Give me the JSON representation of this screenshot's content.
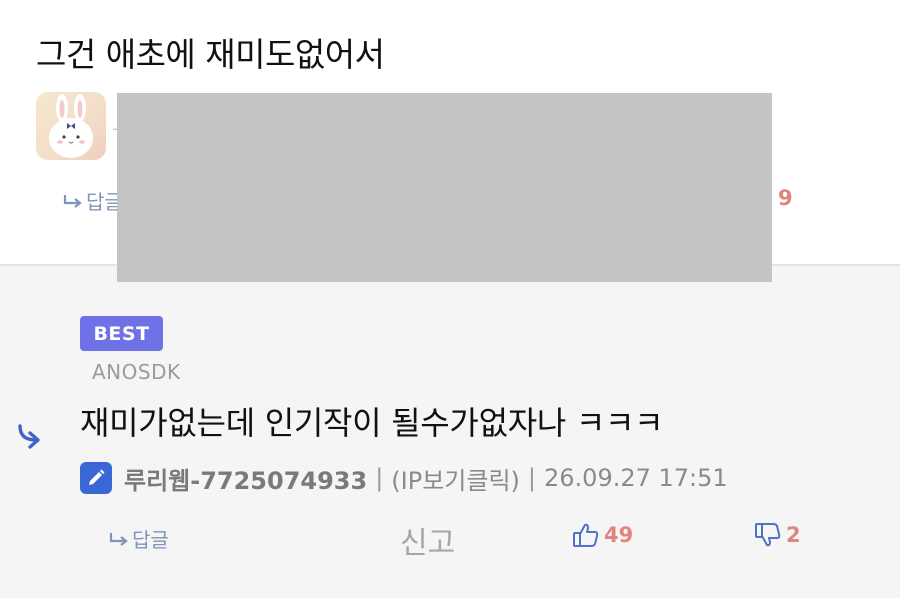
{
  "top_comment": {
    "text": "그건 애초에 재미도없어서",
    "faded_text": "-",
    "reply_label": "답글",
    "dislike_count": "9"
  },
  "best_comment": {
    "badge": "BEST",
    "subtitle": "ANOSDK",
    "text": "재미가없는데 인기작이 될수가없자나 ㅋㅋㅋ",
    "author": "루리웹-7725074933",
    "separator": "|",
    "ip_label": "(IP보기클릭)",
    "timestamp": "26.09.27 17:51",
    "reply_label": "답글",
    "report_label": "신고",
    "like_count": "49",
    "dislike_count": "2"
  },
  "icons": {
    "reply": "reply-arrow-icon",
    "like": "thumbs-up-icon",
    "dislike": "thumbs-down-icon",
    "edit": "pencil-icon"
  },
  "colors": {
    "best_badge": "#6f72e6",
    "link_blue": "#7f94b8",
    "vote_red": "#e0857c",
    "edit_blue": "#3a67d6",
    "redaction": "#c4c4c4"
  }
}
